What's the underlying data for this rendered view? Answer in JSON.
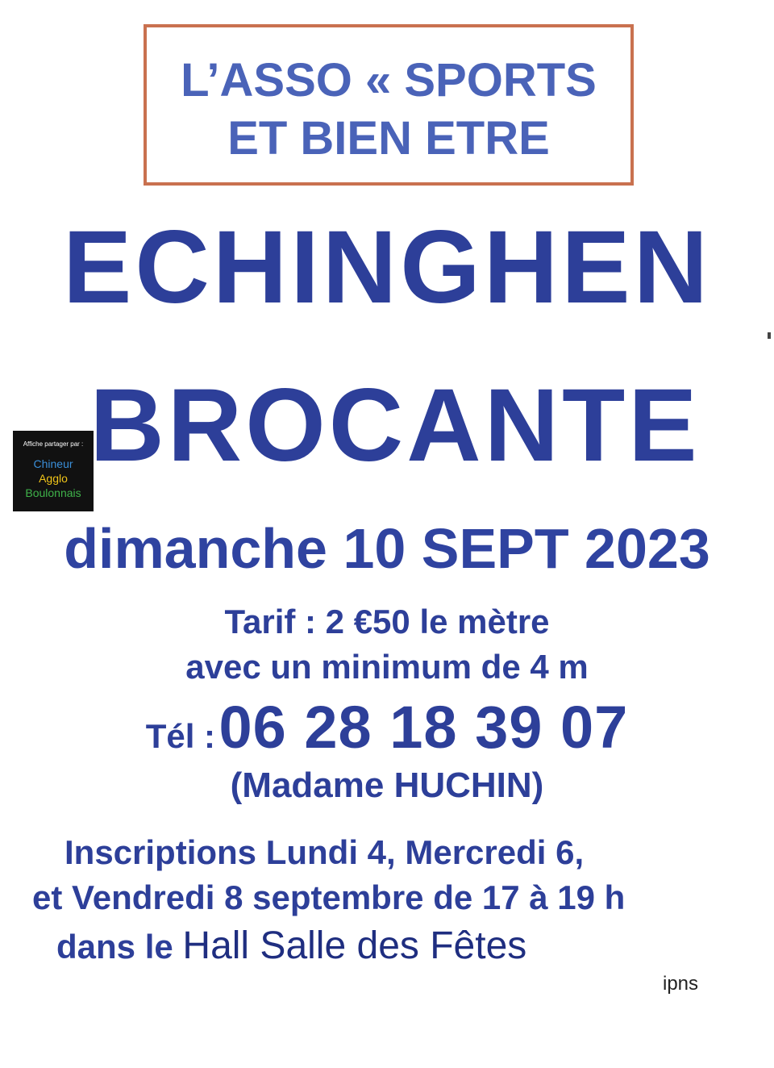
{
  "header_box": {
    "line1": "L’ASSO « SPORTS",
    "line2": "ET BIEN ETRE",
    "border_color": "#c9714f",
    "text_color": "#4a63b8"
  },
  "town": "ECHINGHEN",
  "event": "BROCANTE",
  "date": "dimanche 10 SEPT 2023",
  "pricing": {
    "line1": "Tarif : 2 €50 le mètre",
    "line2": "avec un minimum de 4 m"
  },
  "phone": {
    "label": "Tél :",
    "number": "06 28 18 39 07",
    "contact": "(Madame HUCHIN)"
  },
  "registration": {
    "line1": "Inscriptions Lundi 4, Mercredi 6,",
    "line2": "et Vendredi 8 septembre de 17 à 19 h",
    "line3_prefix": "dans le",
    "line3_place": "Hall Salle des Fêtes"
  },
  "footer_mark": "ipns",
  "share_badge": {
    "caption": "Affiche partager par :",
    "line1": "Chineur",
    "line2": "Agglo",
    "line3": "Boulonnais",
    "colors": {
      "background": "#111111",
      "line1": "#3a8fd9",
      "line2": "#f0c419",
      "line3": "#3fb34a"
    }
  },
  "colors": {
    "primary_text": "#2d3f99",
    "background": "#ffffff"
  }
}
